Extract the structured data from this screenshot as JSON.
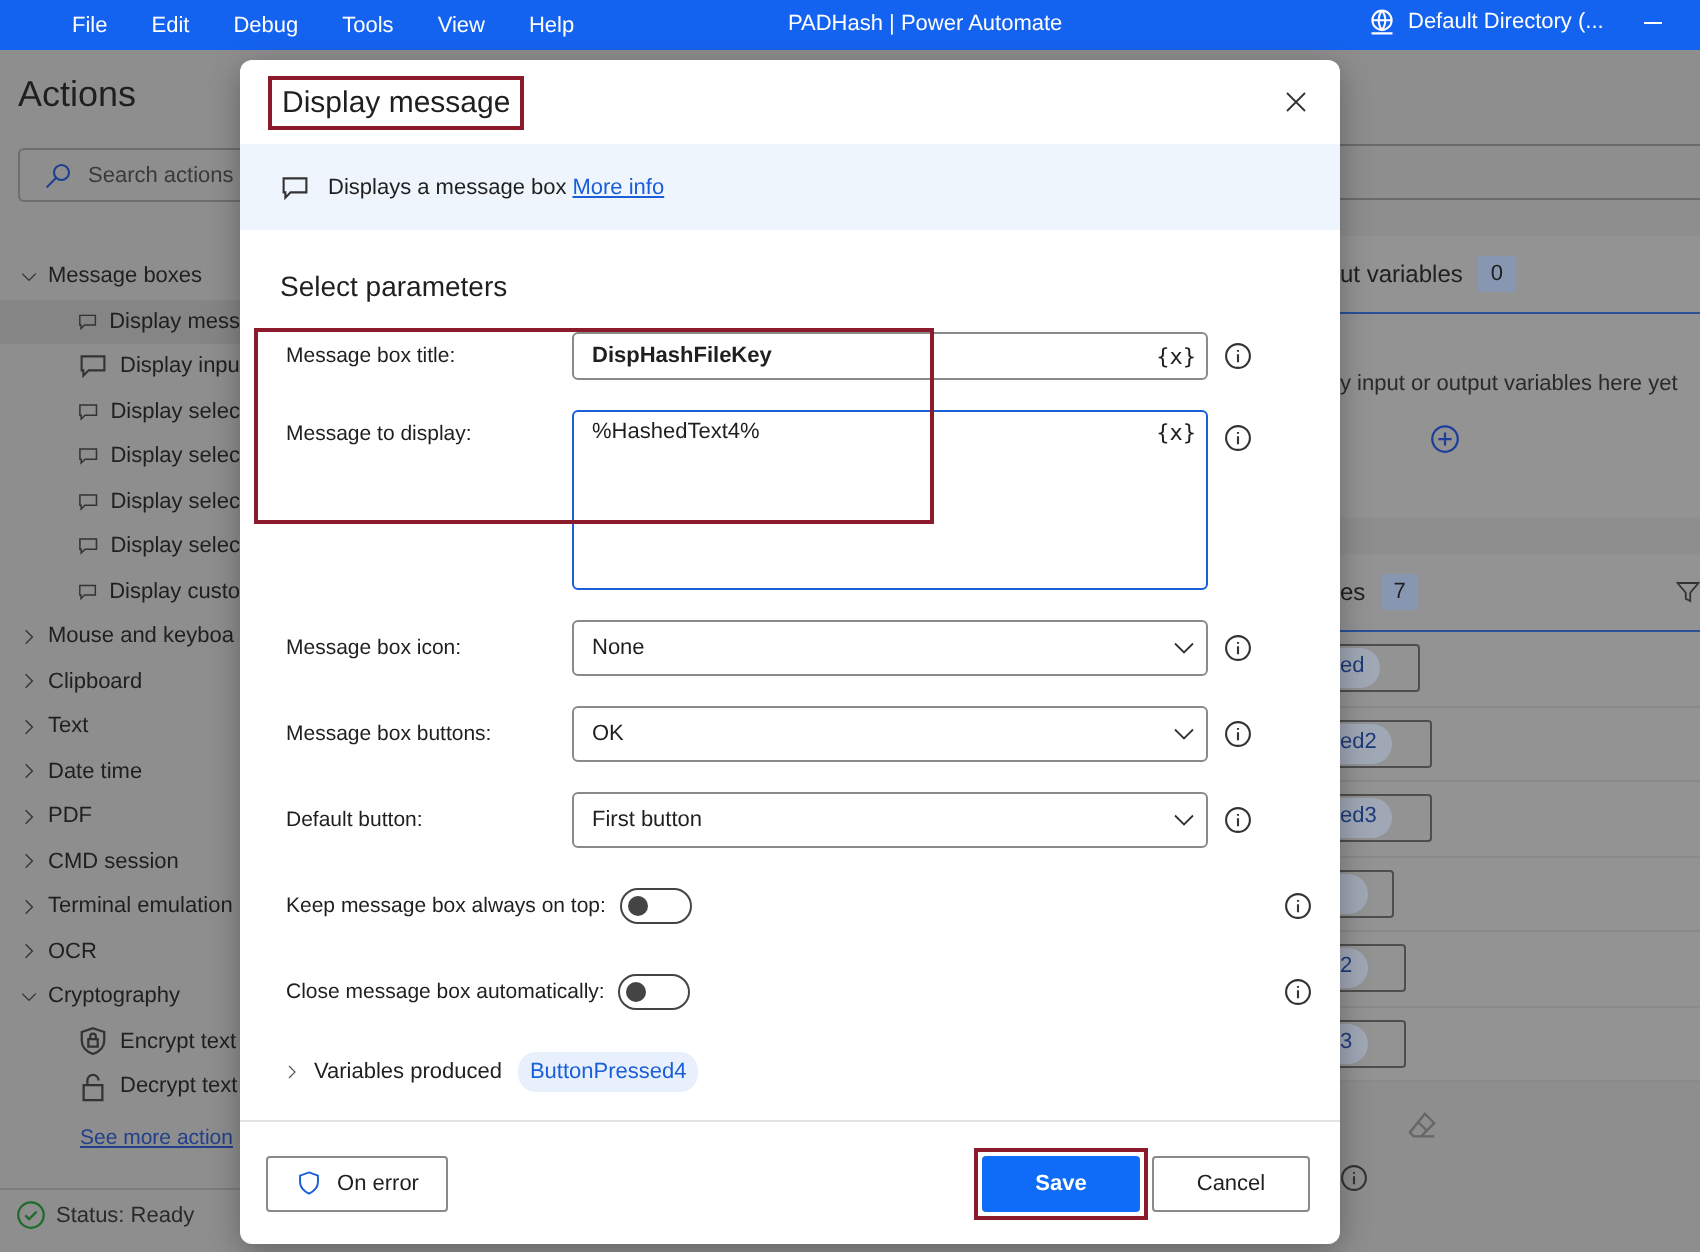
{
  "menu": [
    "File",
    "Edit",
    "Debug",
    "Tools",
    "View",
    "Help"
  ],
  "app_title": "PADHash | Power Automate",
  "account": "Default Directory (...",
  "actions_panel": {
    "title": "Actions",
    "search": {
      "placeholder": "Search actions"
    },
    "groups": [
      {
        "label": "Message boxes",
        "expanded": true,
        "children": [
          {
            "label": "Display mess",
            "kind": "message",
            "selected": true
          },
          {
            "label": "Display inpu",
            "kind": "message",
            "selected": false
          },
          {
            "label": "Display selec",
            "kind": "message",
            "selected": false
          },
          {
            "label": "Display selec",
            "kind": "message",
            "selected": false
          },
          {
            "label": "Display selec",
            "kind": "message",
            "selected": false
          },
          {
            "label": "Display selec",
            "kind": "message",
            "selected": false
          },
          {
            "label": "Display custo",
            "kind": "message",
            "selected": false
          }
        ]
      },
      {
        "label": "Mouse and keyboa",
        "expanded": false
      },
      {
        "label": "Clipboard",
        "expanded": false
      },
      {
        "label": "Text",
        "expanded": false
      },
      {
        "label": "Date time",
        "expanded": false
      },
      {
        "label": "PDF",
        "expanded": false
      },
      {
        "label": "CMD session",
        "expanded": false
      },
      {
        "label": "Terminal emulation",
        "expanded": false
      },
      {
        "label": "OCR",
        "expanded": false
      },
      {
        "label": "Cryptography",
        "expanded": true,
        "children": [
          {
            "label": "Encrypt text",
            "kind": "encrypt",
            "selected": false
          },
          {
            "label": "Decrypt text",
            "kind": "decrypt",
            "selected": false
          }
        ]
      }
    ],
    "more_link": "See more action"
  },
  "status": "Status: Ready",
  "io_variables": {
    "title": "ut variables",
    "count": "0",
    "empty_text": "y input or output variables here yet"
  },
  "flow_variables": {
    "title": "es",
    "count": "7",
    "rows": [
      {
        "kind": "chip",
        "text": "ed"
      },
      {
        "kind": "chip",
        "text": "ed2"
      },
      {
        "kind": "chip",
        "text": "ed3"
      },
      {
        "kind": "blank"
      },
      {
        "kind": "chip",
        "text": "2"
      },
      {
        "kind": "chip",
        "text": "3"
      }
    ]
  },
  "dialog": {
    "title": "Display message",
    "description": "Displays a message box",
    "info_link": "More info",
    "section": "Select parameters",
    "params": [
      {
        "kind": "text",
        "label": "Message box title:",
        "value": "DispHashFileKey",
        "variable_button": "{x}"
      },
      {
        "kind": "textarea",
        "label": "Message to display:",
        "value": "%HashedText4%",
        "variable_button": "{x}"
      },
      {
        "kind": "dropdown",
        "label": "Message box icon:",
        "value": "None"
      },
      {
        "kind": "dropdown",
        "label": "Message box buttons:",
        "value": "OK"
      },
      {
        "kind": "dropdown",
        "label": "Default button:",
        "value": "First button"
      },
      {
        "kind": "toggle",
        "label": "Keep message box always on top:",
        "on": false
      },
      {
        "kind": "toggle",
        "label": "Close message box automatically:",
        "on": false
      }
    ],
    "variables_label": "Variables produced",
    "variables": [
      "ButtonPressed4"
    ],
    "on_error": "On error",
    "save": "Save",
    "cancel": "Cancel"
  }
}
